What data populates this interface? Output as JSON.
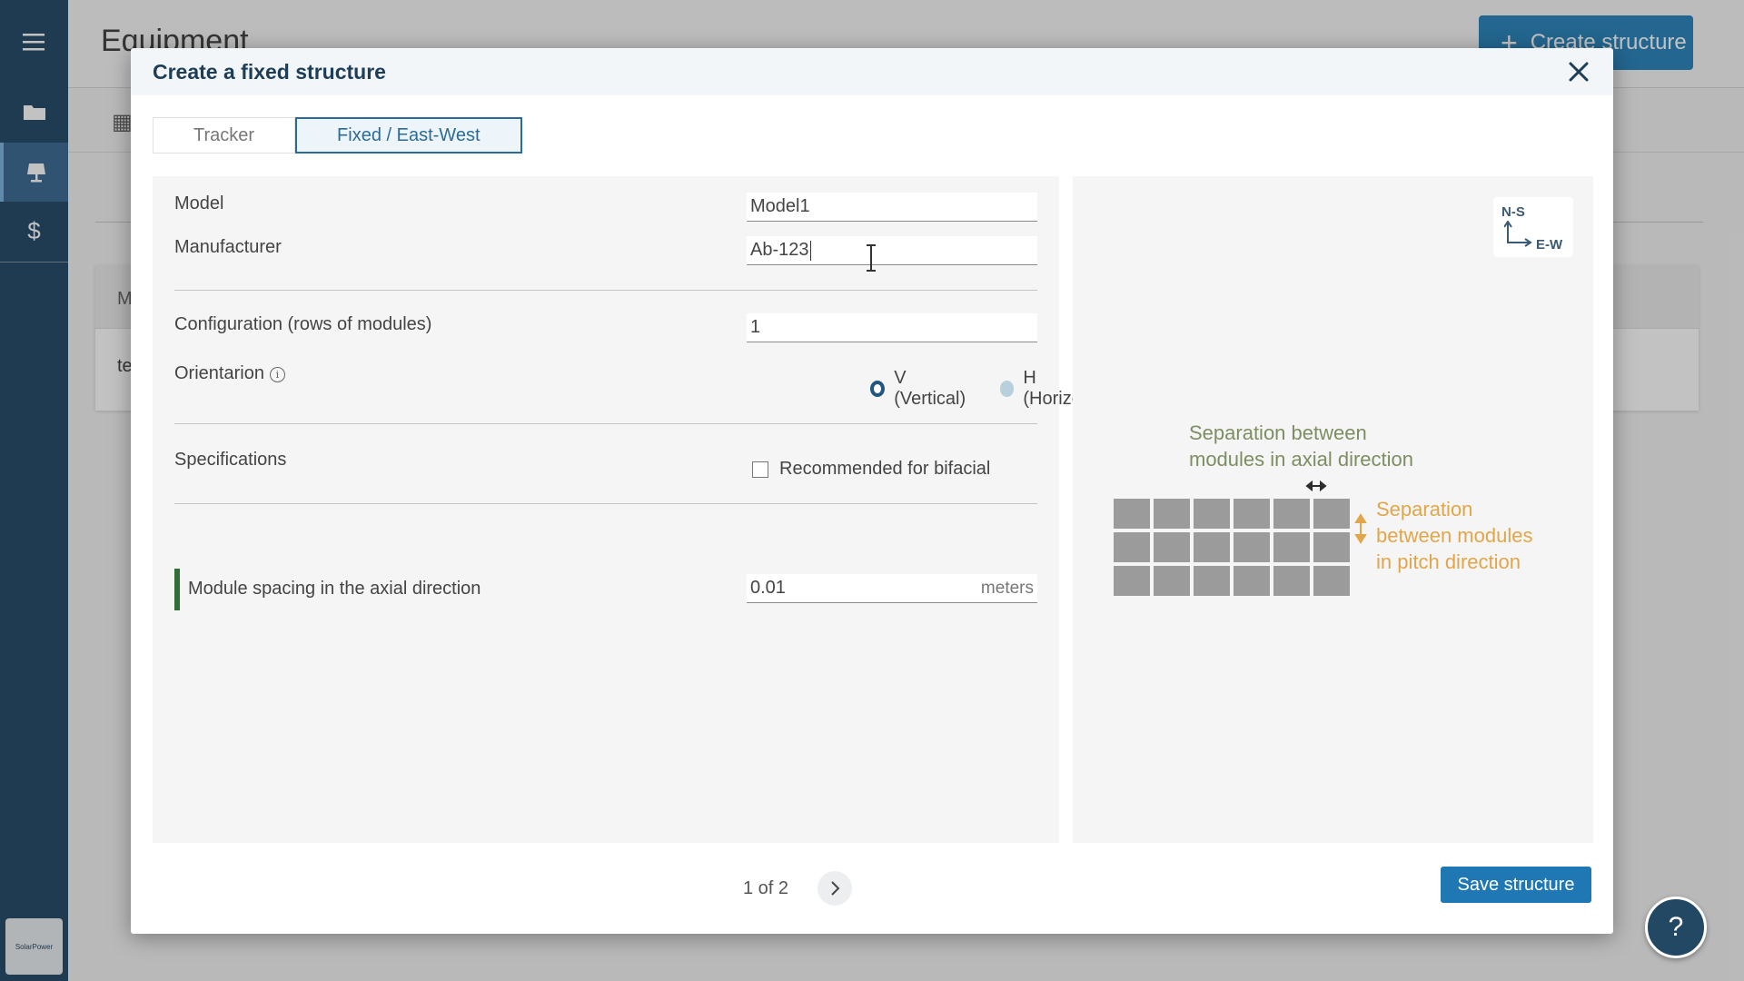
{
  "app": {
    "page_title": "Equipment",
    "create_button_label": "Create structure",
    "background_table_header": "M",
    "background_table_cell": "te",
    "logo_text": "SolarPower"
  },
  "sidebar": {
    "items": [
      {
        "icon": "menu-icon"
      },
      {
        "icon": "folder-icon"
      },
      {
        "icon": "structure-icon",
        "active": true
      },
      {
        "icon": "dollar-icon"
      }
    ]
  },
  "modal": {
    "title": "Create a fixed structure",
    "tabs": [
      {
        "label": "Tracker",
        "active": false
      },
      {
        "label": "Fixed / East-West",
        "active": true
      }
    ],
    "form": {
      "model_label": "Model",
      "model_value": "Model1",
      "manufacturer_label": "Manufacturer",
      "manufacturer_value": "Ab-123",
      "configuration_label": "Configuration (rows of modules)",
      "configuration_value": "1",
      "orientation_label": "Orientarion",
      "orientation_options": [
        {
          "label": "V (Vertical)",
          "selected": true
        },
        {
          "label": "H (Horizontal)",
          "selected": false
        }
      ],
      "specifications_label": "Specifications",
      "bifacial_label": "Recommended for bifacial",
      "bifacial_checked": false,
      "spacing_label": "Module spacing in the axial direction",
      "spacing_value": "0.01",
      "spacing_unit": "meters"
    },
    "diagram": {
      "compass_ns": "N-S",
      "compass_ew": "E-W",
      "axial_text_line1": "Separation between",
      "axial_text_line2": "modules in axial direction",
      "pitch_text_line1": "Separation",
      "pitch_text_line2": "between modules",
      "pitch_text_line3": "in pitch direction",
      "axial_color": "#7d8e62",
      "pitch_color": "#e2a64a"
    },
    "pager": {
      "text": "1 of 2"
    },
    "save_label": "Save structure"
  },
  "help": {
    "label": "?"
  }
}
